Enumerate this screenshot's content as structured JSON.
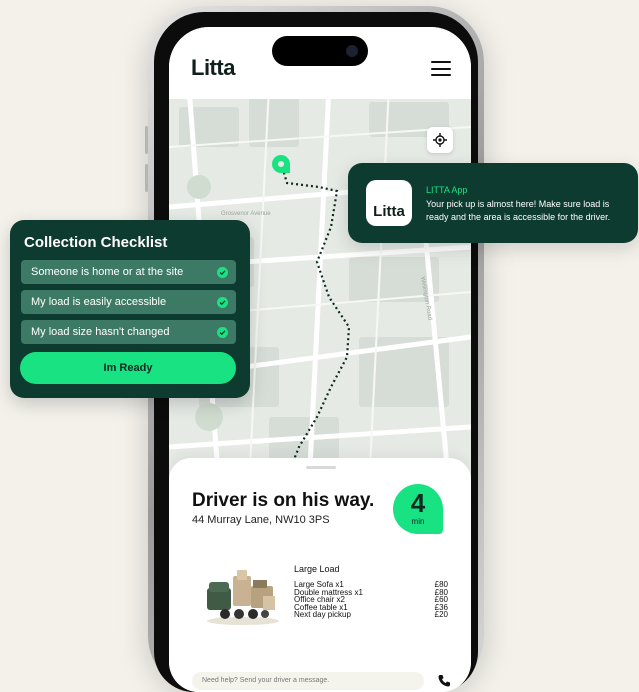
{
  "app": {
    "logo": "Litta"
  },
  "map": {
    "street_1": "Grosvenor Avenue",
    "street_2": "Wellington Road"
  },
  "notification": {
    "logo": "Litta",
    "title": "LITTA App",
    "message": "Your pick up is almost here! Make sure load is ready and the area is accessible for the driver."
  },
  "checklist": {
    "title": "Collection Checklist",
    "items": [
      {
        "label": "Someone is home or at the site"
      },
      {
        "label": "My load is easily accessible"
      },
      {
        "label": "My load size hasn't changed"
      }
    ],
    "button_label": "Im Ready"
  },
  "driver": {
    "title": "Driver is on his way.",
    "address": "44 Murray Lane, NW10 3PS",
    "eta_value": "4",
    "eta_unit": "min"
  },
  "load": {
    "title": "Large Load",
    "items": [
      {
        "name": "Large Sofa x1",
        "price": "£80"
      },
      {
        "name": "Double mattress x1",
        "price": "£80"
      },
      {
        "name": "Office chair x2",
        "price": "£60"
      },
      {
        "name": "Coffee table x1",
        "price": "£36"
      },
      {
        "name": "Next day pickup",
        "price": "£20"
      }
    ]
  },
  "message": {
    "placeholder": "Need help? Send your driver a message."
  },
  "colors": {
    "brand_green": "#19e283",
    "card_dark": "#0e3b2f",
    "item_bg": "#3d7a66"
  }
}
